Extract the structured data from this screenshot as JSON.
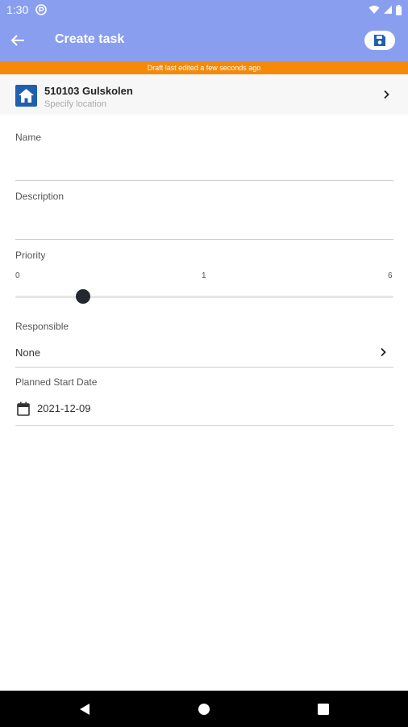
{
  "status_bar": {
    "time": "1:30"
  },
  "app_bar": {
    "title": "Create task"
  },
  "draft_banner": "Draft last edited a few seconds ago",
  "location": {
    "name": "510103 Gulskolen",
    "subtitle": "Specify location"
  },
  "fields": {
    "name_label": "Name",
    "name_value": "",
    "description_label": "Description",
    "description_value": "",
    "priority_label": "Priority",
    "priority_min": "0",
    "priority_mid": "1",
    "priority_max": "6",
    "priority_value": 1,
    "responsible_label": "Responsible",
    "responsible_value": "None",
    "start_date_label": "Planned Start Date",
    "start_date_value": "2021-12-09"
  },
  "colors": {
    "app_bar": "#8a9ef0",
    "banner": "#f5890a",
    "accent_icon": "#1e5fb0"
  },
  "icons": [
    "back-arrow-icon",
    "save-icon",
    "home-icon",
    "chevron-right-icon",
    "calendar-icon",
    "nav-back-icon",
    "nav-home-icon",
    "nav-recents-icon"
  ]
}
